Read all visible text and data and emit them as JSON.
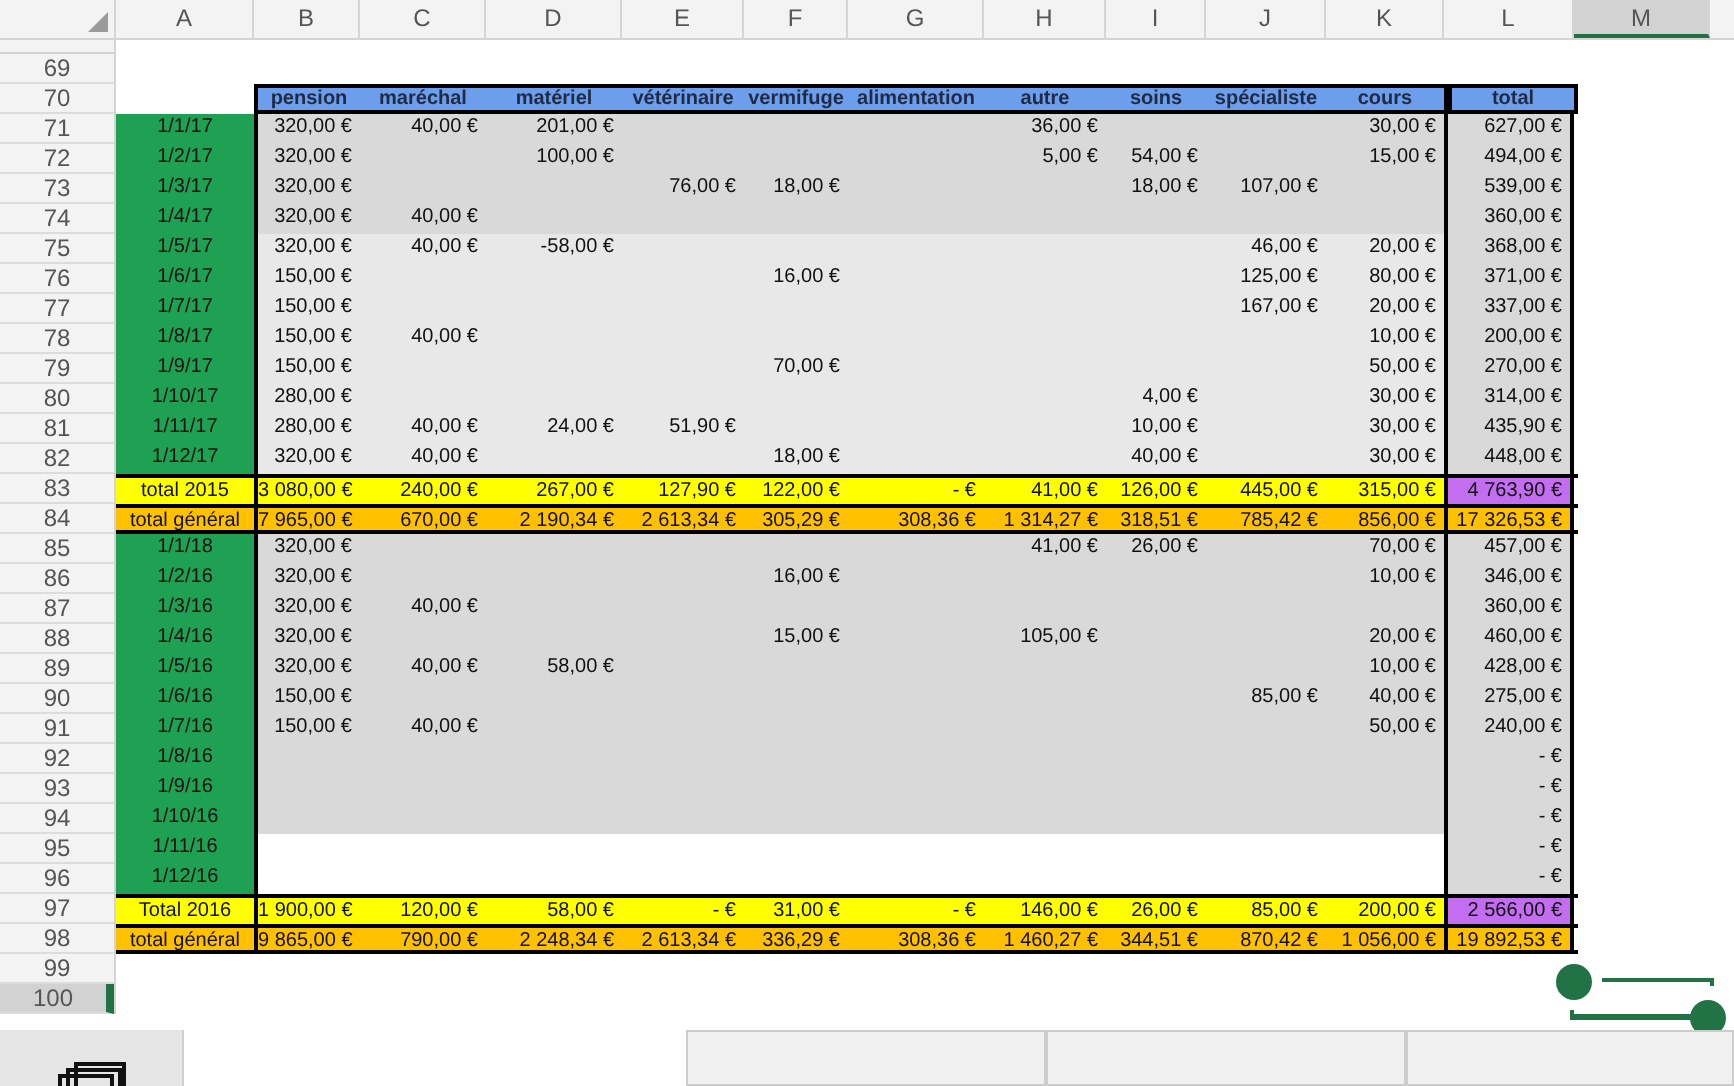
{
  "column_headers": [
    {
      "label": "A",
      "selected": false
    },
    {
      "label": "B",
      "selected": false
    },
    {
      "label": "C",
      "selected": false
    },
    {
      "label": "D",
      "selected": false
    },
    {
      "label": "E",
      "selected": false
    },
    {
      "label": "F",
      "selected": false
    },
    {
      "label": "G",
      "selected": false
    },
    {
      "label": "H",
      "selected": false
    },
    {
      "label": "I",
      "selected": false
    },
    {
      "label": "J",
      "selected": false
    },
    {
      "label": "K",
      "selected": false
    },
    {
      "label": "L",
      "selected": false
    },
    {
      "label": "M",
      "selected": true
    }
  ],
  "row_numbers": [
    {
      "label": "69",
      "selected": false
    },
    {
      "label": "70",
      "selected": false
    },
    {
      "label": "71",
      "selected": false
    },
    {
      "label": "72",
      "selected": false
    },
    {
      "label": "73",
      "selected": false
    },
    {
      "label": "74",
      "selected": false
    },
    {
      "label": "75",
      "selected": false
    },
    {
      "label": "76",
      "selected": false
    },
    {
      "label": "77",
      "selected": false
    },
    {
      "label": "78",
      "selected": false
    },
    {
      "label": "79",
      "selected": false
    },
    {
      "label": "80",
      "selected": false
    },
    {
      "label": "81",
      "selected": false
    },
    {
      "label": "82",
      "selected": false
    },
    {
      "label": "83",
      "selected": false
    },
    {
      "label": "84",
      "selected": false
    },
    {
      "label": "85",
      "selected": false
    },
    {
      "label": "86",
      "selected": false
    },
    {
      "label": "87",
      "selected": false
    },
    {
      "label": "88",
      "selected": false
    },
    {
      "label": "89",
      "selected": false
    },
    {
      "label": "90",
      "selected": false
    },
    {
      "label": "91",
      "selected": false
    },
    {
      "label": "92",
      "selected": false
    },
    {
      "label": "93",
      "selected": false
    },
    {
      "label": "94",
      "selected": false
    },
    {
      "label": "95",
      "selected": false
    },
    {
      "label": "96",
      "selected": false
    },
    {
      "label": "97",
      "selected": false
    },
    {
      "label": "98",
      "selected": false
    },
    {
      "label": "99",
      "selected": false
    },
    {
      "label": "100",
      "selected": true
    }
  ],
  "table": {
    "columns": [
      "pension",
      "maréchal",
      "matériel",
      "vétérinaire",
      "vermifuge",
      "alimentation",
      "autre",
      "soins",
      "spécialiste",
      "cours"
    ],
    "total_column": "total",
    "lines": [
      {
        "kind": "month",
        "color": "#d9d9d9",
        "label": "1/1/17",
        "cells": {
          "B": "320,00 €",
          "C": "40,00 €",
          "D": "201,00 €",
          "H": "36,00 €",
          "K": "30,00 €"
        },
        "total": "627,00 €"
      },
      {
        "kind": "month",
        "color": "#d9d9d9",
        "label": "1/2/17",
        "cells": {
          "B": "320,00 €",
          "D": "100,00 €",
          "H": "5,00 €",
          "I": "54,00 €",
          "K": "15,00 €"
        },
        "total": "494,00 €"
      },
      {
        "kind": "month",
        "color": "#d9d9d9",
        "label": "1/3/17",
        "cells": {
          "B": "320,00 €",
          "E": "76,00 €",
          "F": "18,00 €",
          "I": "18,00 €",
          "J": "107,00 €"
        },
        "total": "539,00 €"
      },
      {
        "kind": "month",
        "color": "#d9d9d9",
        "label": "1/4/17",
        "cells": {
          "B": "320,00 €",
          "C": "40,00 €"
        },
        "total": "360,00 €"
      },
      {
        "kind": "month",
        "color": "#e8e8e8",
        "label": "1/5/17",
        "cells": {
          "B": "320,00 €",
          "C": "40,00 €",
          "D": "-58,00 €",
          "J": "46,00 €",
          "K": "20,00 €"
        },
        "total": "368,00 €"
      },
      {
        "kind": "month",
        "color": "#e8e8e8",
        "label": "1/6/17",
        "cells": {
          "B": "150,00 €",
          "F": "16,00 €",
          "J": "125,00 €",
          "K": "80,00 €"
        },
        "total": "371,00 €"
      },
      {
        "kind": "month",
        "color": "#e8e8e8",
        "label": "1/7/17",
        "cells": {
          "B": "150,00 €",
          "J": "167,00 €",
          "K": "20,00 €"
        },
        "total": "337,00 €"
      },
      {
        "kind": "month",
        "color": "#e8e8e8",
        "label": "1/8/17",
        "cells": {
          "B": "150,00 €",
          "C": "40,00 €",
          "K": "10,00 €"
        },
        "total": "200,00 €"
      },
      {
        "kind": "month",
        "color": "#e8e8e8",
        "label": "1/9/17",
        "cells": {
          "B": "150,00 €",
          "F": "70,00 €",
          "K": "50,00 €"
        },
        "total": "270,00 €"
      },
      {
        "kind": "month",
        "color": "#e8e8e8",
        "label": "1/10/17",
        "cells": {
          "B": "280,00 €",
          "I": "4,00 €",
          "K": "30,00 €"
        },
        "total": "314,00 €"
      },
      {
        "kind": "month",
        "color": "#e8e8e8",
        "label": "1/11/17",
        "cells": {
          "B": "280,00 €",
          "C": "40,00 €",
          "D": "24,00 €",
          "E": "51,90 €",
          "I": "10,00 €",
          "K": "30,00 €"
        },
        "total": "435,90 €"
      },
      {
        "kind": "month",
        "color": "#e8e8e8",
        "label": "1/12/17",
        "cells": {
          "B": "320,00 €",
          "C": "40,00 €",
          "F": "18,00 €",
          "I": "40,00 €",
          "K": "30,00 €"
        },
        "total": "448,00 €"
      },
      {
        "kind": "year_total",
        "label": "total 2015",
        "cells": {
          "B": "3 080,00 €",
          "C": "240,00 €",
          "D": "267,00 €",
          "E": "127,90 €",
          "F": "122,00 €",
          "G": "- €",
          "H": "41,00 €",
          "I": "126,00 €",
          "J": "445,00 €",
          "K": "315,00 €"
        },
        "total": "4 763,90 €"
      },
      {
        "kind": "grand_total",
        "label": "total général",
        "cells": {
          "B": "7 965,00 €",
          "C": "670,00 €",
          "D": "2 190,34 €",
          "E": "2 613,34 €",
          "F": "305,29 €",
          "G": "308,36 €",
          "H": "1 314,27 €",
          "I": "318,51 €",
          "J": "785,42 €",
          "K": "856,00 €"
        },
        "total": "17 326,53 €"
      },
      {
        "kind": "month",
        "color": "#d9d9d9",
        "label": "1/1/18",
        "cells": {
          "B": "320,00 €",
          "H": "41,00 €",
          "I": "26,00 €",
          "K": "70,00 €"
        },
        "total": "457,00 €"
      },
      {
        "kind": "month",
        "color": "#d9d9d9",
        "label": "1/2/16",
        "cells": {
          "B": "320,00 €",
          "F": "16,00 €",
          "K": "10,00 €"
        },
        "total": "346,00 €"
      },
      {
        "kind": "month",
        "color": "#d9d9d9",
        "label": "1/3/16",
        "cells": {
          "B": "320,00 €",
          "C": "40,00 €"
        },
        "total": "360,00 €"
      },
      {
        "kind": "month",
        "color": "#d9d9d9",
        "label": "1/4/16",
        "cells": {
          "B": "320,00 €",
          "F": "15,00 €",
          "H": "105,00 €",
          "K": "20,00 €"
        },
        "total": "460,00 €"
      },
      {
        "kind": "month",
        "color": "#d9d9d9",
        "label": "1/5/16",
        "cells": {
          "B": "320,00 €",
          "C": "40,00 €",
          "D": "58,00 €",
          "K": "10,00 €"
        },
        "total": "428,00 €"
      },
      {
        "kind": "month",
        "color": "#d9d9d9",
        "label": "1/6/16",
        "cells": {
          "B": "150,00 €",
          "J": "85,00 €",
          "K": "40,00 €"
        },
        "total": "275,00 €"
      },
      {
        "kind": "month",
        "color": "#d9d9d9",
        "label": "1/7/16",
        "cells": {
          "B": "150,00 €",
          "C": "40,00 €",
          "K": "50,00 €"
        },
        "total": "240,00 €"
      },
      {
        "kind": "month",
        "color": "#d9d9d9",
        "label": "1/8/16",
        "total": "- €"
      },
      {
        "kind": "month",
        "color": "#d9d9d9",
        "label": "1/9/16",
        "total": "- €"
      },
      {
        "kind": "month",
        "color": "#d9d9d9",
        "label": "1/10/16",
        "total": "- €"
      },
      {
        "kind": "month",
        "color": "#ffffff",
        "label": "1/11/16",
        "total": "- €"
      },
      {
        "kind": "month",
        "color": "#ffffff",
        "label": "1/12/16",
        "total": "- €"
      },
      {
        "kind": "year_total",
        "label": "Total 2016",
        "cells": {
          "B": "1 900,00 €",
          "C": "120,00 €",
          "D": "58,00 €",
          "E": "- €",
          "F": "31,00 €",
          "G": "- €",
          "H": "146,00 €",
          "I": "26,00 €",
          "J": "85,00 €",
          "K": "200,00 €"
        },
        "total": "2 566,00 €"
      },
      {
        "kind": "grand_total",
        "label": "total général",
        "cells": {
          "B": "9 865,00 €",
          "C": "790,00 €",
          "D": "2 248,34 €",
          "E": "2 613,34 €",
          "F": "336,29 €",
          "G": "308,36 €",
          "H": "1 460,27 €",
          "I": "344,51 €",
          "J": "870,42 €",
          "K": "1 056,00 €"
        },
        "total": "19 892,53 €"
      }
    ]
  }
}
